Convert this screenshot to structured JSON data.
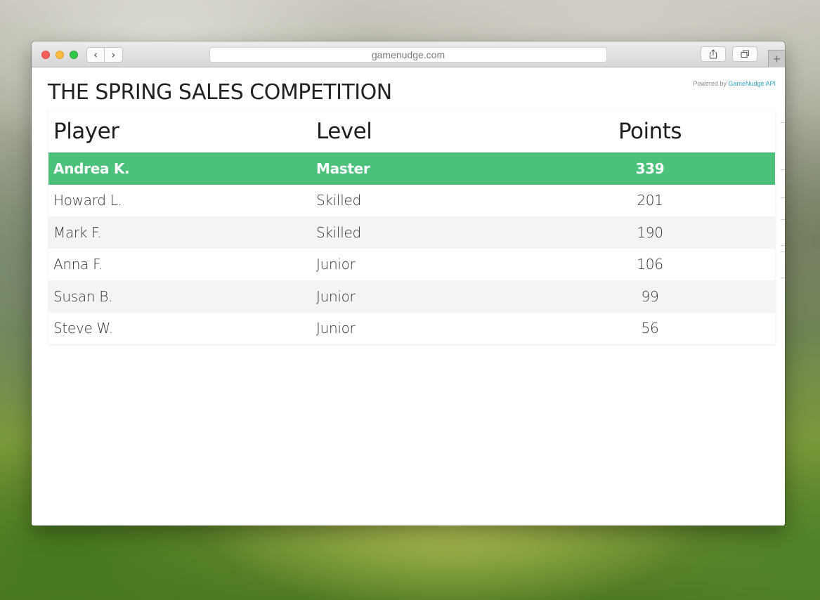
{
  "browser": {
    "url": "gamenudge.com",
    "back_glyph": "‹",
    "forward_glyph": "›",
    "new_tab_glyph": "+",
    "icons": {
      "close": "red-circle",
      "minimize": "yellow-circle",
      "zoom": "green-circle",
      "share": "share-icon",
      "tabs": "tabs-overview-icon"
    }
  },
  "page": {
    "title": "THE SPRING SALES COMPETITION",
    "powered_prefix": "Powered by ",
    "powered_link": "GameNudge API"
  },
  "leaderboard": {
    "headers": {
      "player": "Player",
      "level": "Level",
      "points": "Points"
    },
    "rows": [
      {
        "player": "Andrea K.",
        "level": "Master",
        "points": "339"
      },
      {
        "player": "Howard L.",
        "level": "Skilled",
        "points": "201"
      },
      {
        "player": "Mark F.",
        "level": "Skilled",
        "points": "190"
      },
      {
        "player": "Anna F.",
        "level": "Junior",
        "points": "106"
      },
      {
        "player": "Susan B.",
        "level": "Junior",
        "points": "99"
      },
      {
        "player": "Steve W.",
        "level": "Junior",
        "points": "56"
      }
    ]
  },
  "colors": {
    "leader_row": "#4bc17c",
    "alt_row": "#f4f4f4",
    "link": "#2fa3c8"
  }
}
